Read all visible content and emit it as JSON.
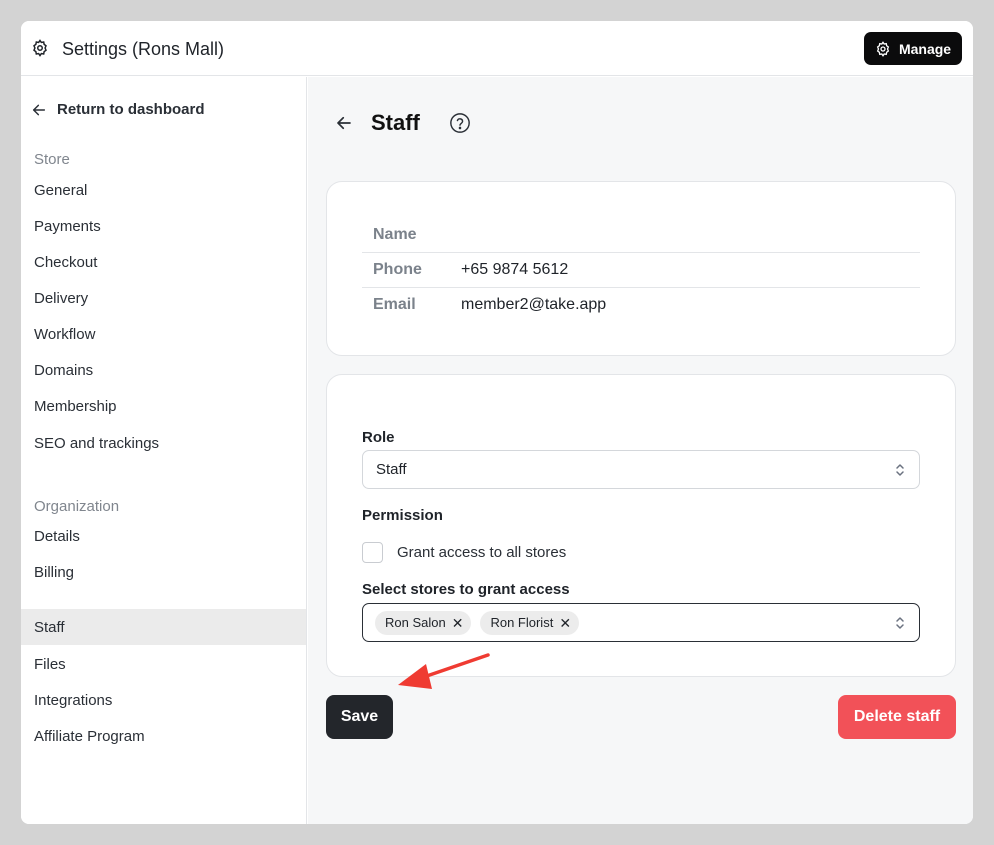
{
  "header": {
    "title": "Settings (Rons Mall)",
    "manage_label": "Manage"
  },
  "sidebar": {
    "return_label": "Return to dashboard",
    "store_section": "Store",
    "store_items": [
      "General",
      "Payments",
      "Checkout",
      "Delivery",
      "Workflow",
      "Domains",
      "Membership",
      "SEO and trackings"
    ],
    "org_section": "Organization",
    "org_items": [
      "Details",
      "Billing",
      "Staff",
      "Files",
      "Integrations",
      "Affiliate Program"
    ],
    "active_item": "Staff"
  },
  "page": {
    "title": "Staff"
  },
  "staff_info": {
    "name_label": "Name",
    "name_value": "",
    "phone_label": "Phone",
    "phone_value": "+65 9874 5612",
    "email_label": "Email",
    "email_value": "member2@take.app"
  },
  "form": {
    "role_label": "Role",
    "role_value": "Staff",
    "permission_label": "Permission",
    "grant_all_label": "Grant access to all stores",
    "grant_all_checked": false,
    "select_stores_label": "Select stores to grant access",
    "selected_stores": [
      "Ron Salon",
      "Ron Florist"
    ]
  },
  "actions": {
    "save_label": "Save",
    "delete_label": "Delete staff"
  },
  "colors": {
    "save": "#23262b",
    "delete": "#f25158",
    "annotation_arrow": "#ef3b32"
  }
}
